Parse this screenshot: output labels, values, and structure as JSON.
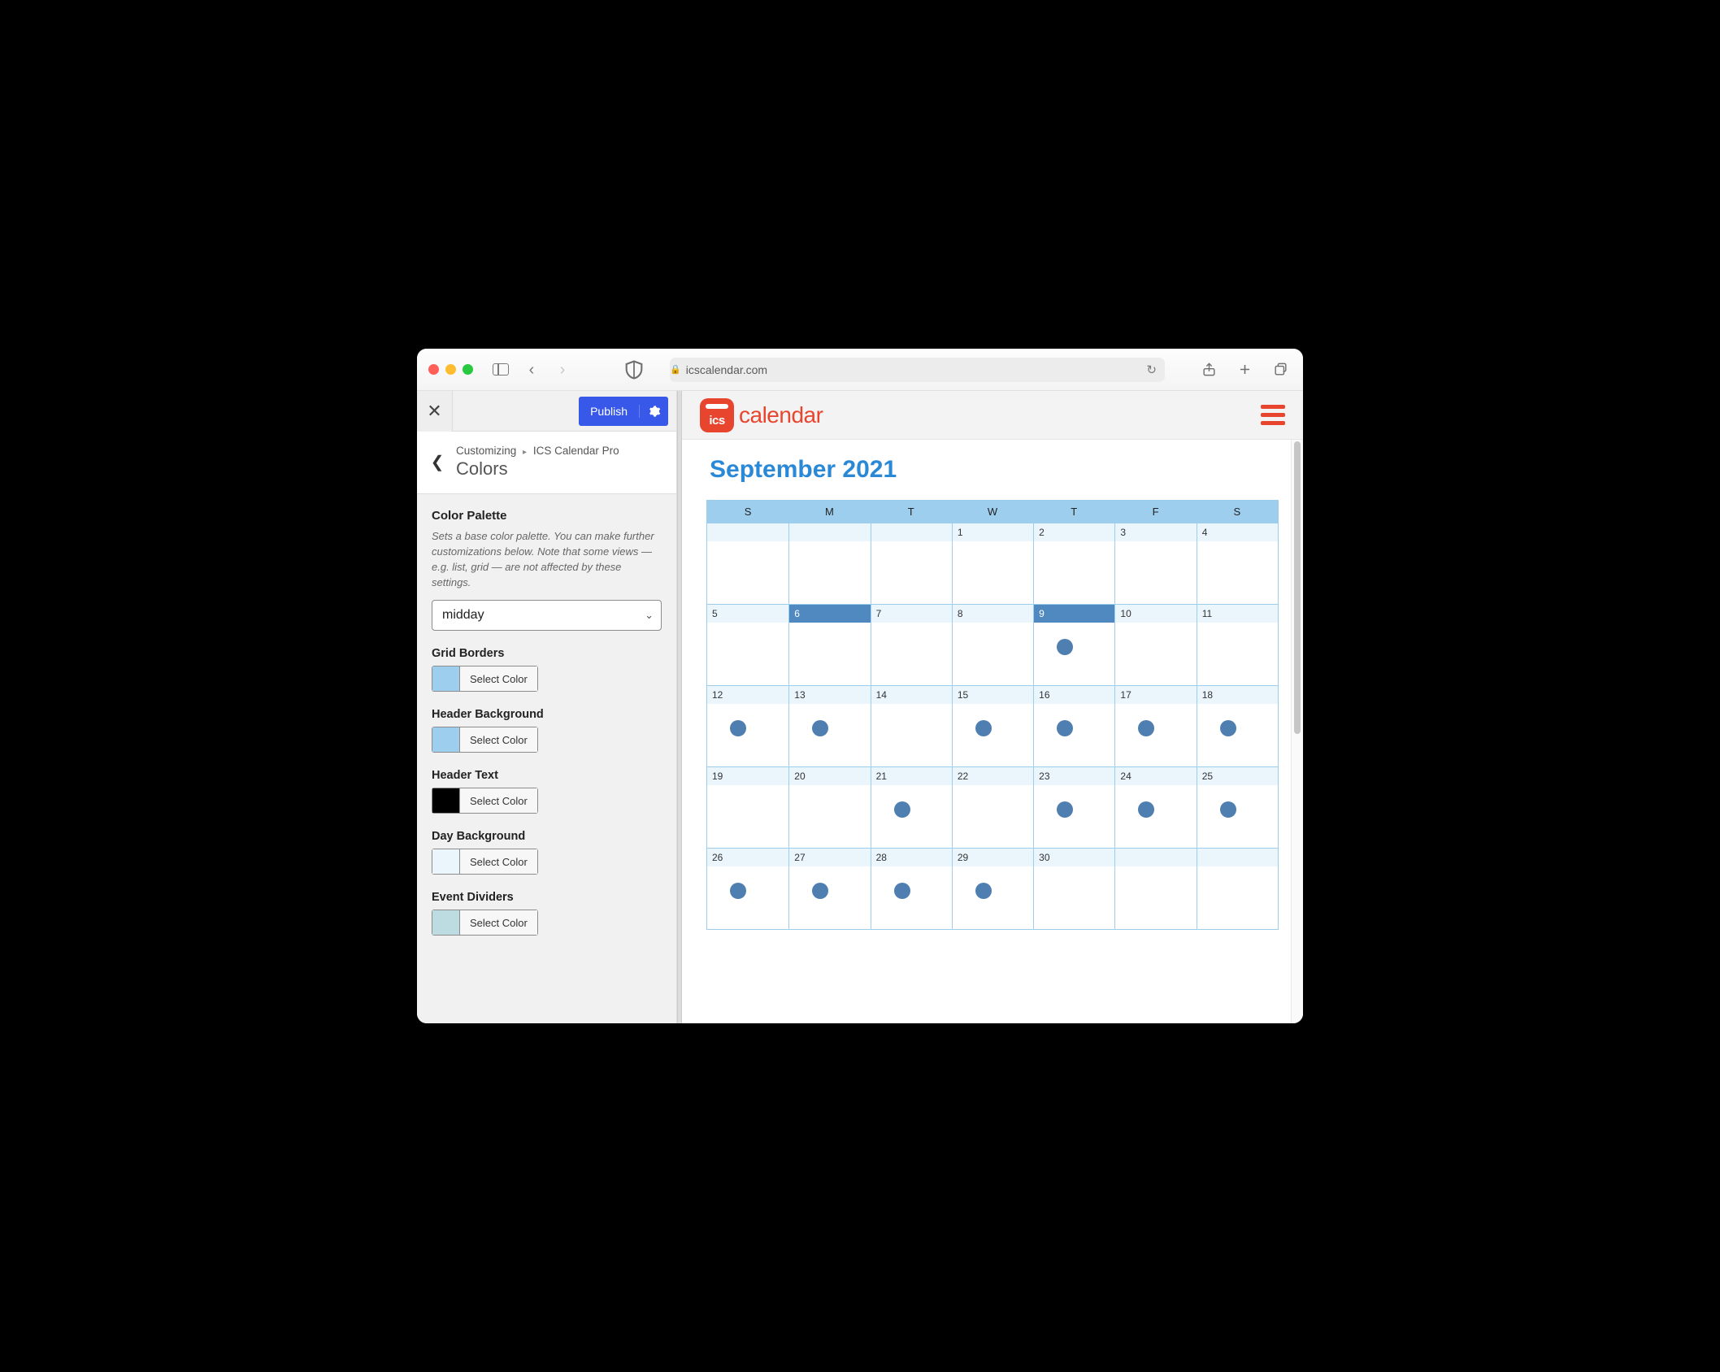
{
  "browser": {
    "address": "icscalendar.com"
  },
  "customizer": {
    "publish_label": "Publish",
    "breadcrumb_root": "Customizing",
    "breadcrumb_leaf": "ICS Calendar Pro",
    "panel_title": "Colors",
    "palette": {
      "heading": "Color Palette",
      "description": "Sets a base color palette. You can make further customizations below. Note that some views — e.g. list, grid — are not affected by these settings.",
      "selected": "midday"
    },
    "select_color_label": "Select Color",
    "controls": [
      {
        "label": "Grid Borders",
        "swatch": "#9dceee"
      },
      {
        "label": "Header Background",
        "swatch": "#9dceee"
      },
      {
        "label": "Header Text",
        "swatch": "#000000"
      },
      {
        "label": "Day Background",
        "swatch": "#eaf5fc"
      },
      {
        "label": "Event Dividers",
        "swatch": "#bcdce2"
      }
    ]
  },
  "site": {
    "logo_text": "calendar"
  },
  "calendar": {
    "title": "September 2021",
    "weekdays": [
      "S",
      "M",
      "T",
      "W",
      "T",
      "F",
      "S"
    ],
    "days": [
      {
        "n": "",
        "sel": false,
        "ev": false
      },
      {
        "n": "",
        "sel": false,
        "ev": false
      },
      {
        "n": "",
        "sel": false,
        "ev": false
      },
      {
        "n": "1",
        "sel": false,
        "ev": false
      },
      {
        "n": "2",
        "sel": false,
        "ev": false
      },
      {
        "n": "3",
        "sel": false,
        "ev": false
      },
      {
        "n": "4",
        "sel": false,
        "ev": false
      },
      {
        "n": "5",
        "sel": false,
        "ev": false
      },
      {
        "n": "6",
        "sel": true,
        "ev": false
      },
      {
        "n": "7",
        "sel": false,
        "ev": false
      },
      {
        "n": "8",
        "sel": false,
        "ev": false
      },
      {
        "n": "9",
        "sel": true,
        "ev": true
      },
      {
        "n": "10",
        "sel": false,
        "ev": false
      },
      {
        "n": "11",
        "sel": false,
        "ev": false
      },
      {
        "n": "12",
        "sel": false,
        "ev": true
      },
      {
        "n": "13",
        "sel": false,
        "ev": true
      },
      {
        "n": "14",
        "sel": false,
        "ev": false
      },
      {
        "n": "15",
        "sel": false,
        "ev": true
      },
      {
        "n": "16",
        "sel": false,
        "ev": true
      },
      {
        "n": "17",
        "sel": false,
        "ev": true
      },
      {
        "n": "18",
        "sel": false,
        "ev": true
      },
      {
        "n": "19",
        "sel": false,
        "ev": false
      },
      {
        "n": "20",
        "sel": false,
        "ev": false
      },
      {
        "n": "21",
        "sel": false,
        "ev": true
      },
      {
        "n": "22",
        "sel": false,
        "ev": false
      },
      {
        "n": "23",
        "sel": false,
        "ev": true
      },
      {
        "n": "24",
        "sel": false,
        "ev": true
      },
      {
        "n": "25",
        "sel": false,
        "ev": true
      },
      {
        "n": "26",
        "sel": false,
        "ev": true
      },
      {
        "n": "27",
        "sel": false,
        "ev": true
      },
      {
        "n": "28",
        "sel": false,
        "ev": true
      },
      {
        "n": "29",
        "sel": false,
        "ev": true
      },
      {
        "n": "30",
        "sel": false,
        "ev": false
      },
      {
        "n": "",
        "sel": false,
        "ev": false
      },
      {
        "n": "",
        "sel": false,
        "ev": false
      }
    ]
  }
}
